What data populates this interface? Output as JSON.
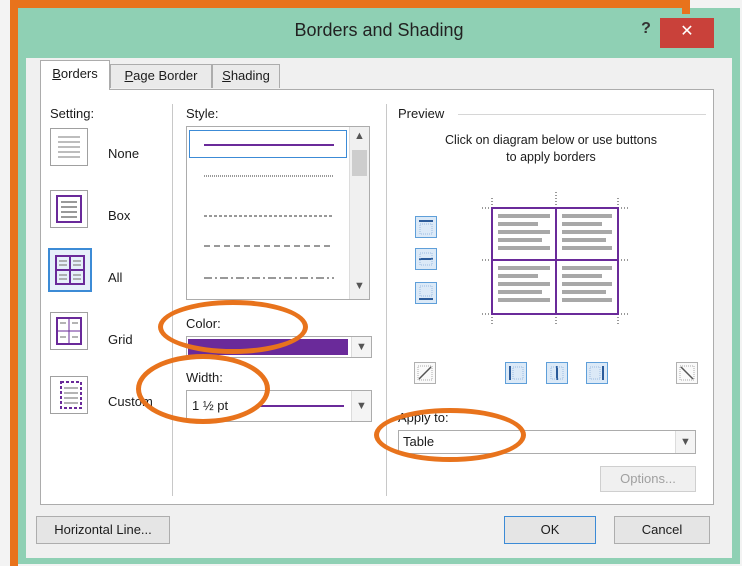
{
  "window": {
    "title": "Borders and Shading",
    "help": "?",
    "close": "✕"
  },
  "tabs": [
    {
      "label_u": "B",
      "label_rest": "orders"
    },
    {
      "label_u": "P",
      "label_rest": "age Border"
    },
    {
      "label_u": "S",
      "label_rest": "hading"
    }
  ],
  "setting": {
    "label": "Setting:",
    "items": [
      {
        "label": "None"
      },
      {
        "label": "Box"
      },
      {
        "label": "All"
      },
      {
        "label": "Grid"
      },
      {
        "label": "Custom"
      }
    ],
    "selected": "All"
  },
  "style": {
    "label": "Style:",
    "lines": [
      "solid",
      "dotted",
      "dashed",
      "dash-large",
      "dash-dot"
    ]
  },
  "color": {
    "label": "Color:",
    "value_color": "#6a2a9a"
  },
  "width": {
    "label": "Width:",
    "value": "1 ½ pt"
  },
  "preview": {
    "label": "Preview",
    "hint": "Click on diagram below or use buttons to apply borders"
  },
  "apply_to": {
    "label": "Apply to:",
    "value": "Table"
  },
  "buttons": {
    "options": "Options...",
    "horizontal_line": "Horizontal Line...",
    "ok": "OK",
    "cancel": "Cancel"
  },
  "colors": {
    "accent_orange": "#e8731c",
    "titlebar": "#8fd0b4",
    "close": "#c9413a",
    "border_purple": "#6a2a9a"
  }
}
